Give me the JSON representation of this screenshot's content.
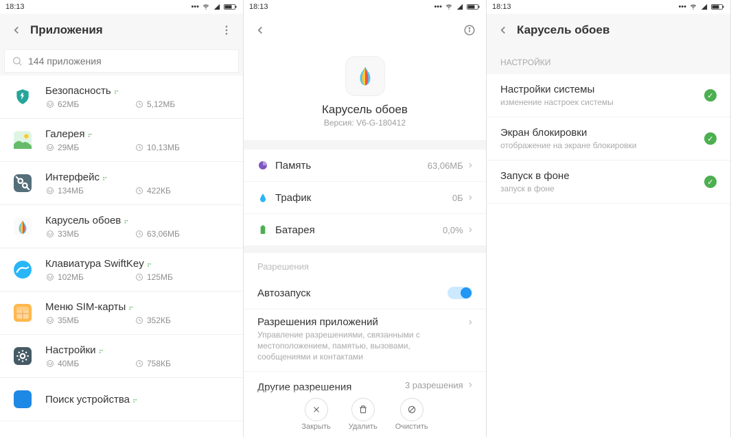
{
  "status": {
    "time": "18:13"
  },
  "pane1": {
    "title": "Приложения",
    "search_placeholder": "144 приложения",
    "apps": [
      {
        "name": "Безопасность",
        "size": "62МБ",
        "data": "5,12МБ"
      },
      {
        "name": "Галерея",
        "size": "29МБ",
        "data": "10,13МБ"
      },
      {
        "name": "Интерфейс",
        "size": "134МБ",
        "data": "422КБ"
      },
      {
        "name": "Карусель обоев",
        "size": "33МБ",
        "data": "63,06МБ"
      },
      {
        "name": "Клавиатура SwiftKey",
        "size": "102МБ",
        "data": "125МБ"
      },
      {
        "name": "Меню SIM-карты",
        "size": "35МБ",
        "data": "352КБ"
      },
      {
        "name": "Настройки",
        "size": "40МБ",
        "data": "758КБ"
      },
      {
        "name": "Поиск устройства",
        "size": "",
        "data": ""
      }
    ]
  },
  "pane2": {
    "app_name": "Карусель обоев",
    "version_label": "Версия: V6-G-180412",
    "metrics": {
      "memory_label": "Память",
      "memory_value": "63,06МБ",
      "traffic_label": "Трафик",
      "traffic_value": "0Б",
      "battery_label": "Батарея",
      "battery_value": "0,0%"
    },
    "perm_section": "Разрешения",
    "autostart_label": "Автозапуск",
    "app_perms_title": "Разрешения приложений",
    "app_perms_desc": "Управление разрешениями, связанными с местоположением, памятью, вызовами, сообщениями и контактами",
    "other_perms_title": "Другие разрешения",
    "other_perms_value": "3 разрешения",
    "actions": {
      "close": "Закрыть",
      "delete": "Удалить",
      "clear": "Очистить"
    }
  },
  "pane3": {
    "title": "Карусель обоев",
    "section": "НАСТРОЙКИ",
    "items": [
      {
        "title": "Настройки системы",
        "desc": "изменение настроек системы"
      },
      {
        "title": "Экран блокировки",
        "desc": "отображение на экране блокировки"
      },
      {
        "title": "Запуск в фоне",
        "desc": "запуск в фоне"
      }
    ]
  }
}
